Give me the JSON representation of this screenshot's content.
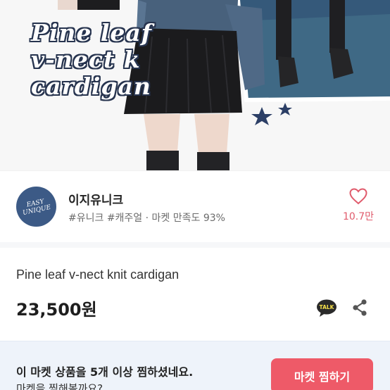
{
  "photo": {
    "caption_lines": [
      "Pine leaf",
      "v-nect k",
      "cardigan"
    ],
    "alt": "product photo"
  },
  "seller": {
    "avatar_text_1": "EASY",
    "avatar_text_2": "UNIQUE",
    "name": "이지유니크",
    "meta": "#유니크 #캐주얼 · 마켓 만족도 93%",
    "like_count": "10.7만"
  },
  "product": {
    "title": "Pine leaf v-nect knit cardigan",
    "price": "23,500원",
    "talk_label": "TALK"
  },
  "banner": {
    "message": "이 마켓 상품을 5개 이상 찜하셨네요.",
    "sub_message": "마켓을 찜해볼까요?",
    "button_label": "마켓 찜하기"
  },
  "colors": {
    "accent": "#ee5a68",
    "like": "#e05b6c",
    "banner_bg": "#eef3fa",
    "avatar_bg": "#3c5a86"
  }
}
